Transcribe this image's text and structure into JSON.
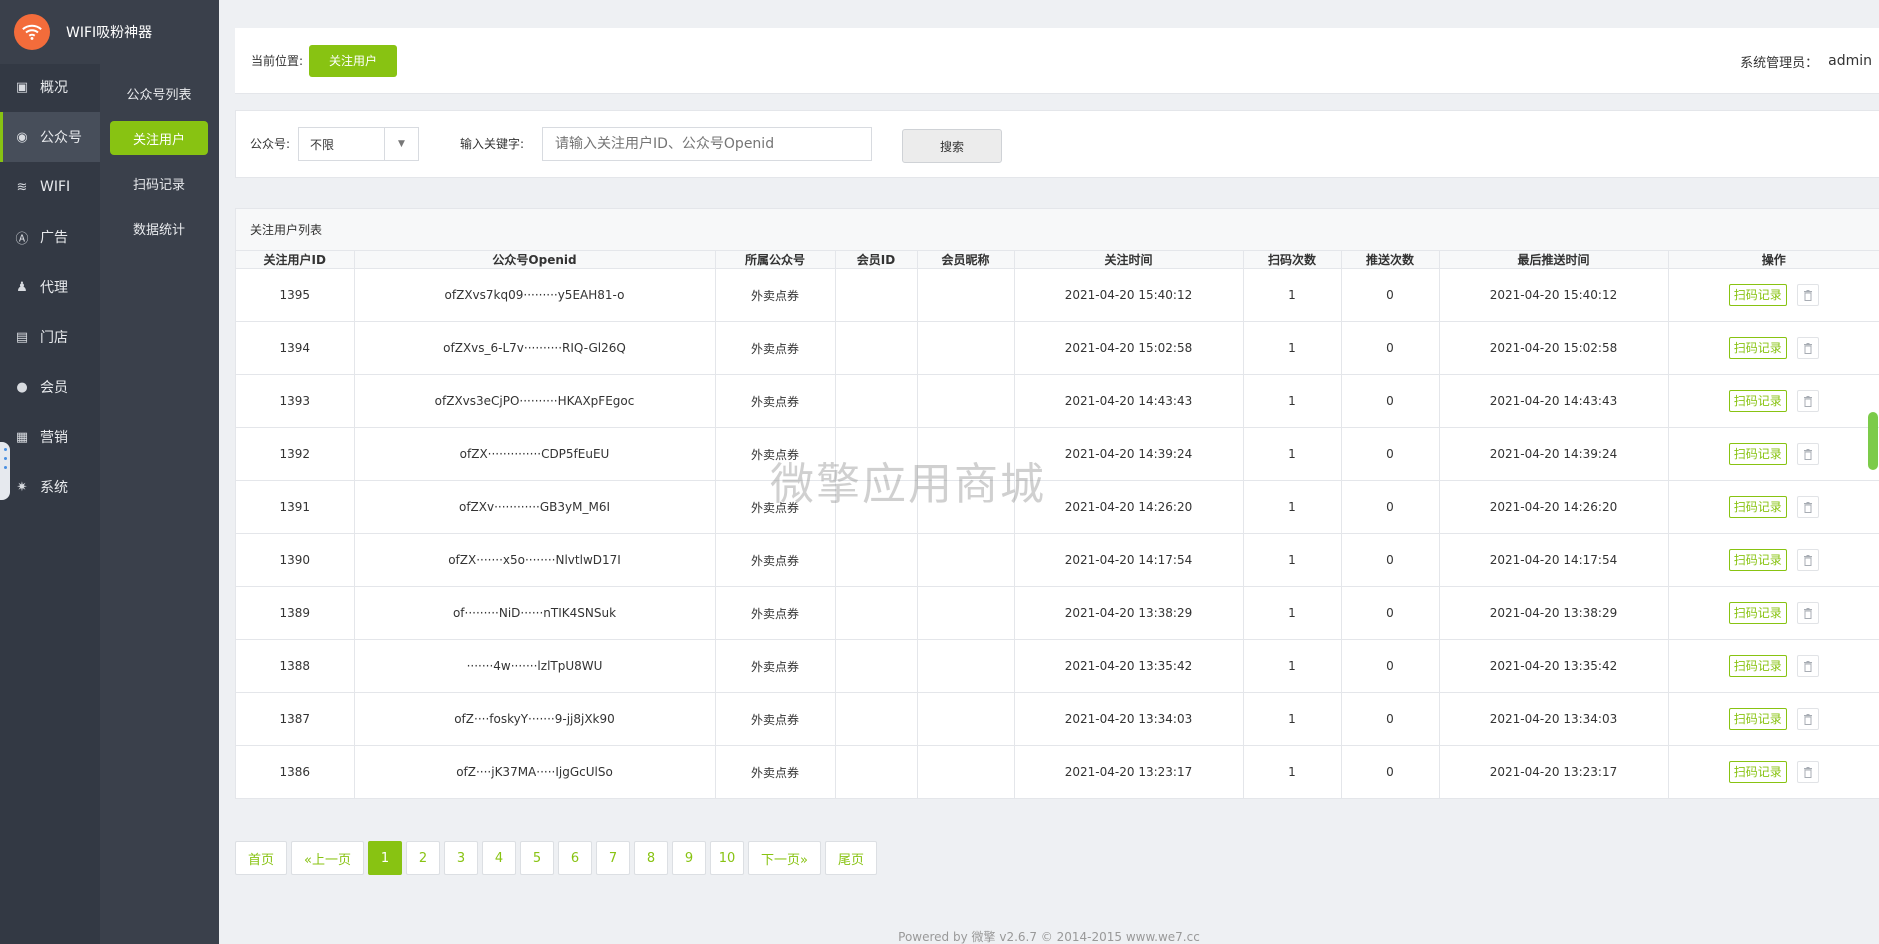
{
  "app": {
    "title": "WIFI吸粉神器"
  },
  "nav": {
    "items": [
      {
        "label": "概况",
        "icon": "chart-icon",
        "active": false
      },
      {
        "label": "公众号",
        "icon": "wechat-icon",
        "active": true
      },
      {
        "label": "WIFI",
        "icon": "wifi-icon",
        "active": false
      },
      {
        "label": "广告",
        "icon": "ad-icon",
        "active": false
      },
      {
        "label": "代理",
        "icon": "agent-icon",
        "active": false
      },
      {
        "label": "门店",
        "icon": "store-icon",
        "active": false
      },
      {
        "label": "会员",
        "icon": "member-icon",
        "active": false
      },
      {
        "label": "营销",
        "icon": "gift-icon",
        "active": false
      },
      {
        "label": "系统",
        "icon": "gear-icon",
        "active": false
      }
    ]
  },
  "subnav": {
    "items": [
      {
        "label": "公众号列表",
        "active": false
      },
      {
        "label": "关注用户",
        "active": true
      },
      {
        "label": "扫码记录",
        "active": false
      },
      {
        "label": "数据统计",
        "active": false
      }
    ]
  },
  "header": {
    "crumb_label": "当前位置:",
    "crumb_current": "关注用户",
    "admin_label": "系统管理员：",
    "admin_name": "admin"
  },
  "filter": {
    "account_label": "公众号:",
    "account_value": "不限",
    "keyword_label": "输入关键字:",
    "keyword_placeholder": "请输入关注用户ID、公众号Openid",
    "search_label": "搜索"
  },
  "table": {
    "title": "关注用户列表",
    "columns": [
      "关注用户ID",
      "公众号Openid",
      "所属公众号",
      "会员ID",
      "会员昵称",
      "关注时间",
      "扫码次数",
      "推送次数",
      "最后推送时间",
      "操作"
    ],
    "action_label": "扫码记录",
    "rows": [
      {
        "id": "1395",
        "openid": "ofZXvs7kq09·········y5EAH81-o",
        "account": "外卖点券",
        "member_id": "",
        "nickname": "",
        "follow_time": "2021-04-20 15:40:12",
        "scan": "1",
        "push": "0",
        "last_push": "2021-04-20 15:40:12"
      },
      {
        "id": "1394",
        "openid": "ofZXvs_6-L7v··········RIQ-Gl26Q",
        "account": "外卖点券",
        "member_id": "",
        "nickname": "",
        "follow_time": "2021-04-20 15:02:58",
        "scan": "1",
        "push": "0",
        "last_push": "2021-04-20 15:02:58"
      },
      {
        "id": "1393",
        "openid": "ofZXvs3eCjPO··········HKAXpFEgoc",
        "account": "外卖点券",
        "member_id": "",
        "nickname": "",
        "follow_time": "2021-04-20 14:43:43",
        "scan": "1",
        "push": "0",
        "last_push": "2021-04-20 14:43:43"
      },
      {
        "id": "1392",
        "openid": "ofZX··············CDP5fEuEU",
        "account": "外卖点券",
        "member_id": "",
        "nickname": "",
        "follow_time": "2021-04-20 14:39:24",
        "scan": "1",
        "push": "0",
        "last_push": "2021-04-20 14:39:24"
      },
      {
        "id": "1391",
        "openid": "ofZXv············GB3yM_M6I",
        "account": "外卖点券",
        "member_id": "",
        "nickname": "",
        "follow_time": "2021-04-20 14:26:20",
        "scan": "1",
        "push": "0",
        "last_push": "2021-04-20 14:26:20"
      },
      {
        "id": "1390",
        "openid": "ofZX·······x5o········NlvtlwD17I",
        "account": "外卖点券",
        "member_id": "",
        "nickname": "",
        "follow_time": "2021-04-20 14:17:54",
        "scan": "1",
        "push": "0",
        "last_push": "2021-04-20 14:17:54"
      },
      {
        "id": "1389",
        "openid": "of·········NiD······nTIK4SNSuk",
        "account": "外卖点券",
        "member_id": "",
        "nickname": "",
        "follow_time": "2021-04-20 13:38:29",
        "scan": "1",
        "push": "0",
        "last_push": "2021-04-20 13:38:29"
      },
      {
        "id": "1388",
        "openid": "·······4w·······lzlTpU8WU",
        "account": "外卖点券",
        "member_id": "",
        "nickname": "",
        "follow_time": "2021-04-20 13:35:42",
        "scan": "1",
        "push": "0",
        "last_push": "2021-04-20 13:35:42"
      },
      {
        "id": "1387",
        "openid": "ofZ····foskyY·······9-jj8jXk90",
        "account": "外卖点券",
        "member_id": "",
        "nickname": "",
        "follow_time": "2021-04-20 13:34:03",
        "scan": "1",
        "push": "0",
        "last_push": "2021-04-20 13:34:03"
      },
      {
        "id": "1386",
        "openid": "ofZ····jK37MA·····IjgGcUlSo",
        "account": "外卖点券",
        "member_id": "",
        "nickname": "",
        "follow_time": "2021-04-20 13:23:17",
        "scan": "1",
        "push": "0",
        "last_push": "2021-04-20 13:23:17"
      }
    ]
  },
  "pagination": {
    "first": "首页",
    "prev": "«上一页",
    "pages": [
      "1",
      "2",
      "3",
      "4",
      "5",
      "6",
      "7",
      "8",
      "9",
      "10"
    ],
    "current": "1",
    "next": "下一页»",
    "last": "尾页"
  },
  "footer": {
    "text": "Powered by 微擎 v2.6.7 © 2014-2015 www.we7.cc"
  },
  "watermark": {
    "text": "微擎应用商城"
  },
  "colors": {
    "accent": "#88c312",
    "sidebar": "#333944",
    "subnav": "#3a404b"
  }
}
